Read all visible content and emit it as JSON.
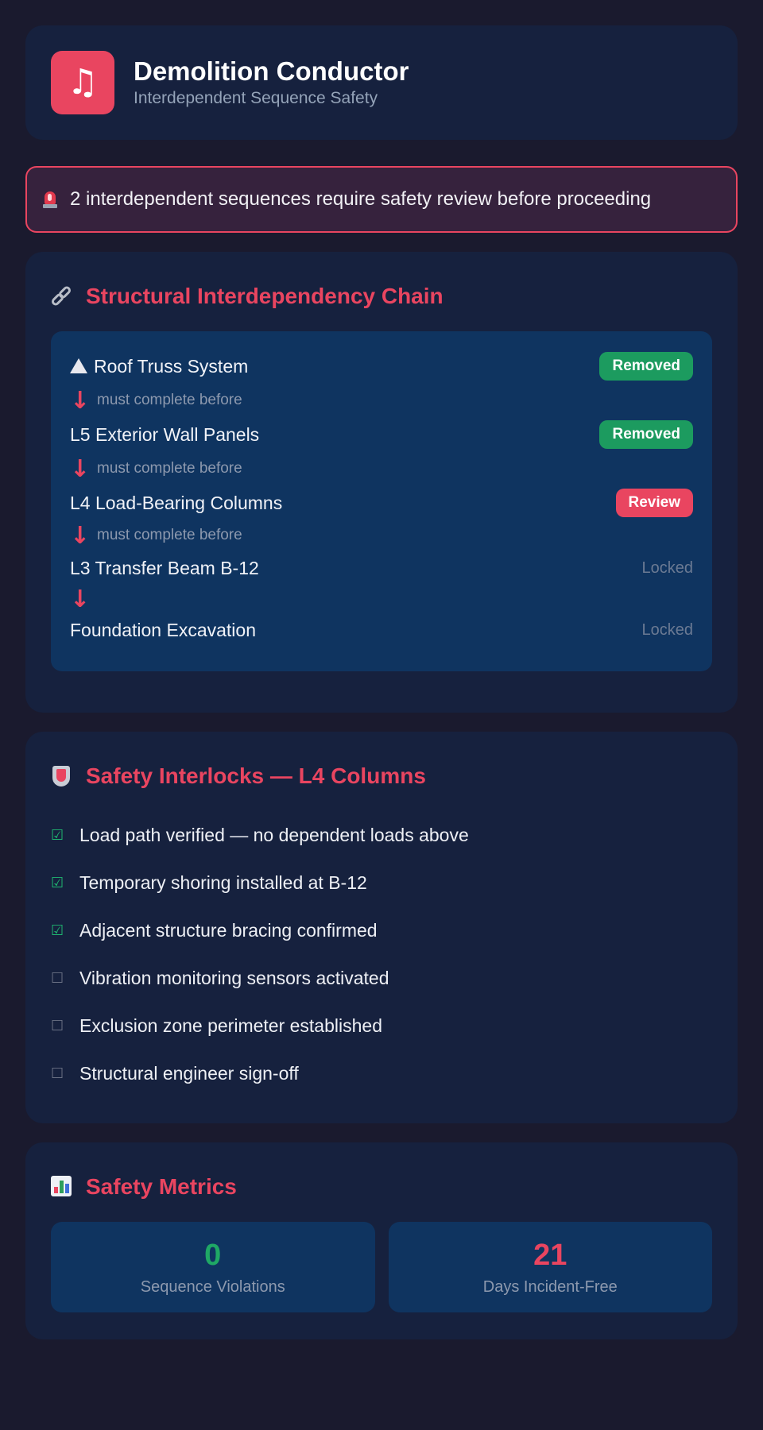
{
  "header": {
    "icon": "music-note-icon",
    "icon_glyph": "♫",
    "title": "Demolition Conductor",
    "subtitle": "Interdependent Sequence Safety"
  },
  "alert": {
    "icon": "siren-icon",
    "text": "2 interdependent sequences require safety review before proceeding"
  },
  "chain": {
    "icon": "link-icon",
    "title": "Structural Interdependency Chain",
    "arrow_glyph": "↓",
    "steps": [
      {
        "name": "Roof Truss System",
        "status": "Removed",
        "connector": "must complete before"
      },
      {
        "name": "L5 Exterior Wall Panels",
        "status": "Removed",
        "connector": "must complete before"
      },
      {
        "name": "L4 Load-Bearing Columns",
        "status": "Review",
        "connector": "must complete before"
      },
      {
        "name": "L3 Transfer Beam B-12",
        "status": "Locked",
        "connector": ""
      },
      {
        "name": "Foundation Excavation",
        "status": "Locked"
      }
    ]
  },
  "interlocks": {
    "icon": "shield-icon",
    "title": "Safety Interlocks — L4 Columns",
    "checked_glyph": "☑",
    "unchecked_glyph": "☐",
    "items": [
      {
        "label": "Load path verified — no dependent loads above",
        "checked": true
      },
      {
        "label": "Temporary shoring installed at B-12",
        "checked": true
      },
      {
        "label": "Adjacent structure bracing confirmed",
        "checked": true
      },
      {
        "label": "Vibration monitoring sensors activated",
        "checked": false
      },
      {
        "label": "Exclusion zone perimeter established",
        "checked": false
      },
      {
        "label": "Structural engineer sign-off",
        "checked": false
      }
    ]
  },
  "metrics": {
    "icon": "bar-chart-icon",
    "title": "Safety Metrics",
    "items": [
      {
        "value": "0",
        "label": "Sequence Violations",
        "color": "#1fa865"
      },
      {
        "value": "21",
        "label": "Days Incident-Free",
        "color": "#e94560"
      }
    ]
  },
  "colors": {
    "accent": "#e94560",
    "success": "#1c9b5f",
    "panel": "#16213e",
    "inner_panel": "#0f3460",
    "background": "#1a1a2e"
  }
}
